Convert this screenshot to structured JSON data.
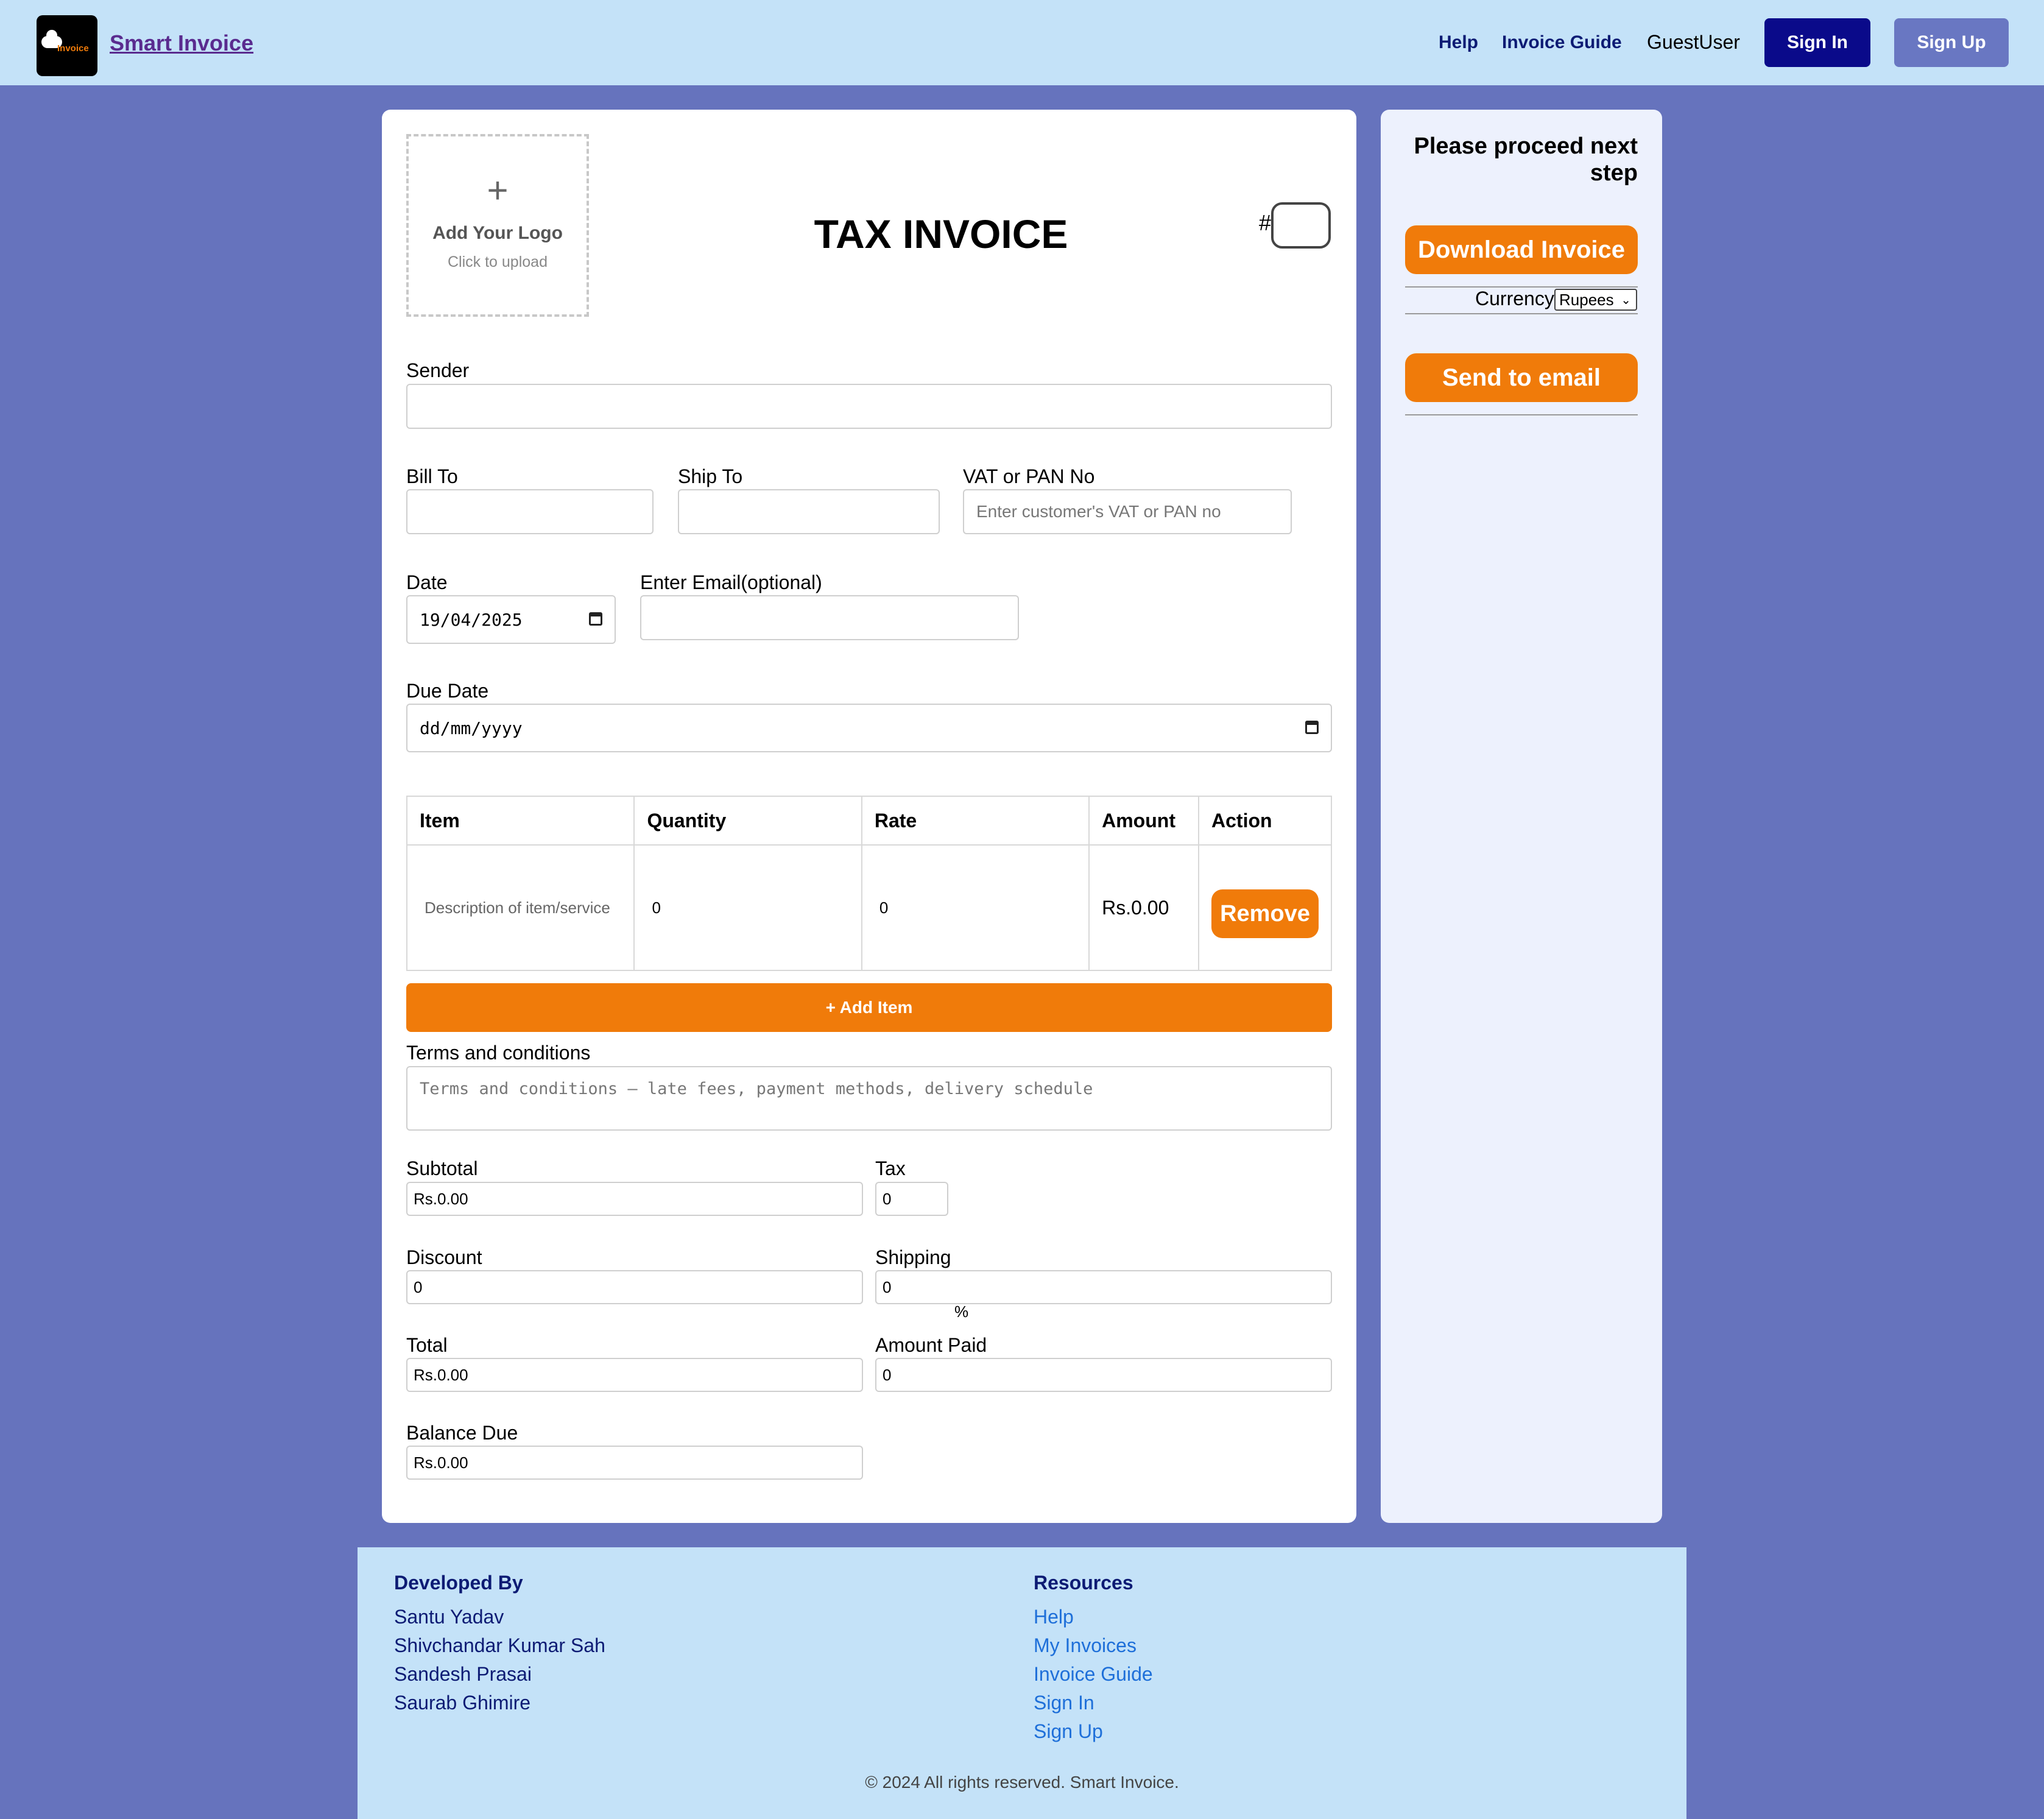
{
  "header": {
    "logo_text": "Invoice",
    "brand": "Smart Invoice",
    "nav": {
      "help": "Help",
      "guide": "Invoice Guide",
      "user": "GuestUser"
    },
    "sign_in": "Sign In",
    "sign_up": "Sign Up"
  },
  "invoice": {
    "logo_upload": {
      "icon": "+",
      "title": "Add Your Logo",
      "hint": "Click to upload"
    },
    "title": "TAX INVOICE",
    "number_prefix": "#",
    "number_value": "",
    "sender": {
      "label": "Sender",
      "value": ""
    },
    "bill_to": {
      "label": "Bill To",
      "value": ""
    },
    "ship_to": {
      "label": "Ship To",
      "value": ""
    },
    "vat": {
      "label": "VAT or PAN No",
      "placeholder": "Enter customer's VAT or PAN no"
    },
    "date": {
      "label": "Date",
      "value": "19/04/2025"
    },
    "email": {
      "label": "Enter Email(optional)",
      "value": ""
    },
    "due_date": {
      "label": "Due Date",
      "value": "dd/mm/yyyy"
    },
    "table": {
      "headers": [
        "Item",
        "Quantity",
        "Rate",
        "Amount",
        "Action"
      ],
      "rows": [
        {
          "item": "Description of item/service",
          "quantity": "0",
          "rate": "0",
          "amount": "Rs.0.00",
          "action": "Remove"
        }
      ]
    },
    "add_item": "+ Add Item",
    "terms": {
      "label": "Terms and conditions",
      "placeholder": "Terms and conditions – late fees, payment methods, delivery schedule"
    },
    "subtotal": {
      "label": "Subtotal",
      "value": "Rs.0.00"
    },
    "tax": {
      "label": "Tax",
      "value": "0",
      "unit": "%"
    },
    "discount": {
      "label": "Discount",
      "value": "0"
    },
    "shipping": {
      "label": "Shipping",
      "value": "0"
    },
    "total": {
      "label": "Total",
      "value": "Rs.0.00"
    },
    "amount_paid": {
      "label": "Amount Paid",
      "value": "0"
    },
    "balance_due": {
      "label": "Balance Due",
      "value": "Rs.0.00"
    }
  },
  "side": {
    "title": "Please proceed next step",
    "download": "Download Invoice",
    "currency_label": "Currency",
    "currency_value": "Rupees",
    "send_email": "Send to email"
  },
  "footer": {
    "developed_by": "Developed By",
    "developers": [
      "Santu Yadav",
      "Shivchandar Kumar Sah",
      "Sandesh Prasai",
      "Saurab Ghimire"
    ],
    "resources": "Resources",
    "links": [
      "Help",
      "My Invoices",
      "Invoice Guide",
      "Sign In",
      "Sign Up"
    ],
    "copyright": "© 2024 All rights reserved. Smart Invoice."
  },
  "colors": {
    "background": "#6673bd",
    "header": "#c4e2f8",
    "accent": "#f07b0a",
    "nav_text": "#0d1b74",
    "signin_button": "#0a0a8a",
    "signup_button": "#6977c2",
    "side_panel": "#edf1fd",
    "link": "#1e6fd9"
  },
  "icons": [
    "cloud-logo-icon",
    "plus-icon",
    "calendar-icon",
    "chevron-down-icon"
  ]
}
